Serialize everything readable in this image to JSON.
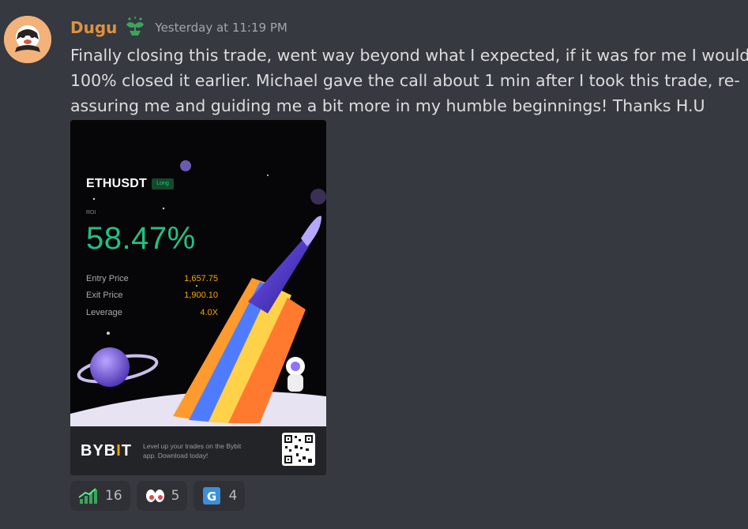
{
  "message": {
    "author": "Dugu",
    "timestamp": "Yesterday at 11:19 PM",
    "lines": [
      "Finally closing this trade, went way beyond what I expected, if it was for me I would of",
      "100% closed it earlier. Michael gave the call about 1 min after I took this trade, re-",
      "assuring me and guiding me a bit more in my humble beginnings! Thanks H.U"
    ]
  },
  "attachment": {
    "symbol": "ETHUSDT",
    "side_badge": "Long",
    "roi_label": "ROI",
    "roi_value": "58.47%",
    "rows": [
      {
        "label": "Entry Price",
        "value": "1,657.75"
      },
      {
        "label": "Exit Price",
        "value": "1,900.10"
      },
      {
        "label": "Leverage",
        "value": "4.0X"
      }
    ],
    "footer": {
      "logo_left": "BYB",
      "logo_bar": "I",
      "logo_right": "T",
      "promo_line1": "Level up your trades on the Bybit",
      "promo_line2": "app. Download today!"
    }
  },
  "reactions": [
    {
      "icon": "chart-increasing-icon",
      "count": "16"
    },
    {
      "icon": "eyes-icon",
      "count": "5"
    },
    {
      "icon": "letter-g-icon",
      "count": "4"
    }
  ],
  "colors": {
    "background": "#36393f",
    "username": "#e0913f",
    "roi_green": "#22c084",
    "bybit_orange": "#f7a600"
  }
}
